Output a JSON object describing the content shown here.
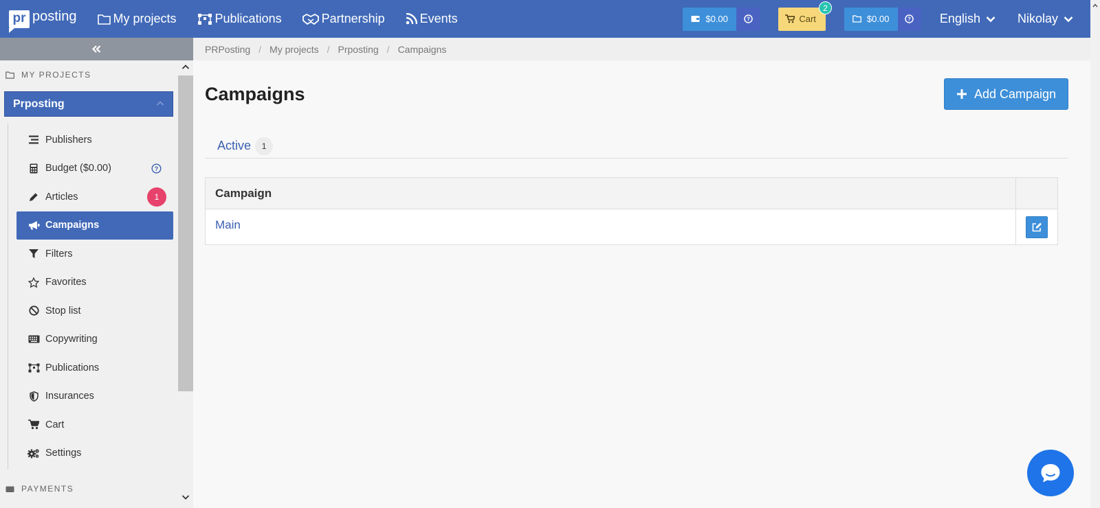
{
  "brand": {
    "logo_mark": "pr",
    "logo_text": "posting"
  },
  "nav": {
    "items": [
      {
        "label": "My projects",
        "icon": "folder-icon"
      },
      {
        "label": "Publications",
        "icon": "nodes-icon"
      },
      {
        "label": "Partnership",
        "icon": "handshake-icon"
      },
      {
        "label": "Events",
        "icon": "rss-icon"
      }
    ]
  },
  "topbar": {
    "wallet_balance": "$0.00",
    "cart_label": "Cart",
    "cart_count": "2",
    "project_balance": "$0.00",
    "language": "English",
    "user": "Nikolay"
  },
  "sidebar": {
    "section_projects": "MY PROJECTS",
    "project_name": "Prposting",
    "items": [
      {
        "label": "Publishers",
        "icon": "list-icon"
      },
      {
        "label": "Budget ($0.00)",
        "icon": "calculator-icon"
      },
      {
        "label": "Articles",
        "icon": "pencil-icon",
        "badge": "1"
      },
      {
        "label": "Campaigns",
        "icon": "megaphone-icon",
        "active": true
      },
      {
        "label": "Filters",
        "icon": "filter-icon"
      },
      {
        "label": "Favorites",
        "icon": "star-icon"
      },
      {
        "label": "Stop list",
        "icon": "ban-icon"
      },
      {
        "label": "Copywriting",
        "icon": "keyboard-icon"
      },
      {
        "label": "Publications",
        "icon": "nodes-icon"
      },
      {
        "label": "Insurances",
        "icon": "shield-icon"
      },
      {
        "label": "Cart",
        "icon": "cart-icon"
      },
      {
        "label": "Settings",
        "icon": "gears-icon"
      }
    ],
    "section_payments": "PAYMENTS"
  },
  "breadcrumb": [
    "PRPosting",
    "My projects",
    "Prposting",
    "Campaigns"
  ],
  "main": {
    "title": "Campaigns",
    "add_button": "Add Campaign",
    "tab_label": "Active",
    "tab_count": "1",
    "table": {
      "header": "Campaign",
      "rows": [
        {
          "name": "Main"
        }
      ]
    }
  },
  "colors": {
    "primary": "#4169b8",
    "accent": "#3d8fd9",
    "cart": "#f6d77a",
    "badge": "#e7426b",
    "chat": "#1e74e8"
  }
}
